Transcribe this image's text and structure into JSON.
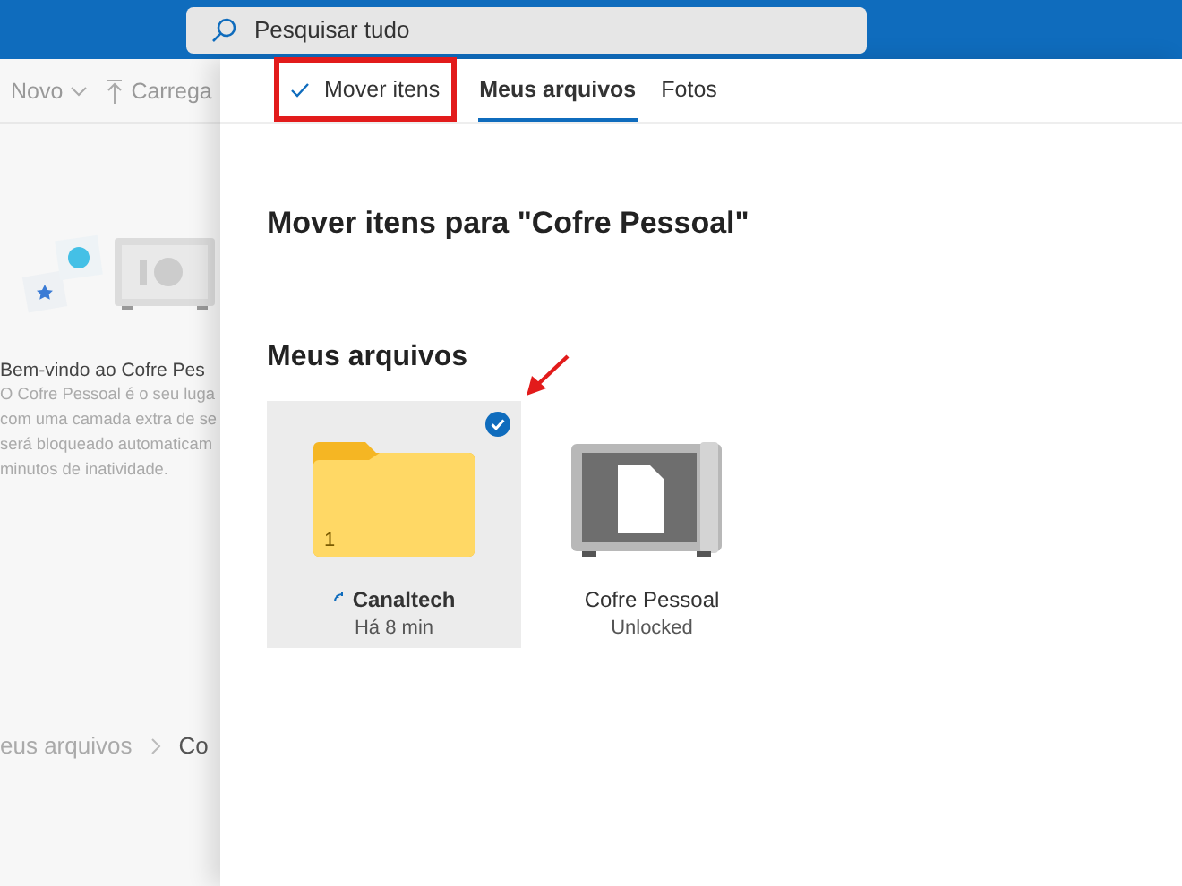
{
  "search": {
    "placeholder": "Pesquisar tudo"
  },
  "background": {
    "toolbar": [
      {
        "kind": "new",
        "label": "Novo"
      },
      {
        "kind": "upload",
        "label": "Carrega"
      }
    ],
    "welcome_title": "Bem-vindo ao Cofre Pes",
    "welcome_lines": [
      "O Cofre Pessoal é o seu luga",
      "com uma camada extra de se",
      "será bloqueado automaticam",
      "minutos de inatividade."
    ],
    "breadcrumb": [
      "eus arquivos",
      "Co"
    ]
  },
  "panel": {
    "command": {
      "label": "Mover itens",
      "highlighted": true
    },
    "tabs": [
      {
        "label": "Meus arquivos",
        "selected": true
      },
      {
        "label": "Fotos",
        "selected": false
      }
    ],
    "title": "Mover itens para \"Cofre Pessoal\"",
    "section": "Meus arquivos",
    "items": [
      {
        "kind": "folder",
        "name": "Canaltech",
        "meta": "Há 8 min",
        "count": "1",
        "syncing": true,
        "selected": true,
        "pointed": true
      },
      {
        "kind": "vault",
        "name": "Cofre Pessoal",
        "meta": "Unlocked",
        "syncing": false,
        "selected": false,
        "pointed": false
      }
    ]
  }
}
